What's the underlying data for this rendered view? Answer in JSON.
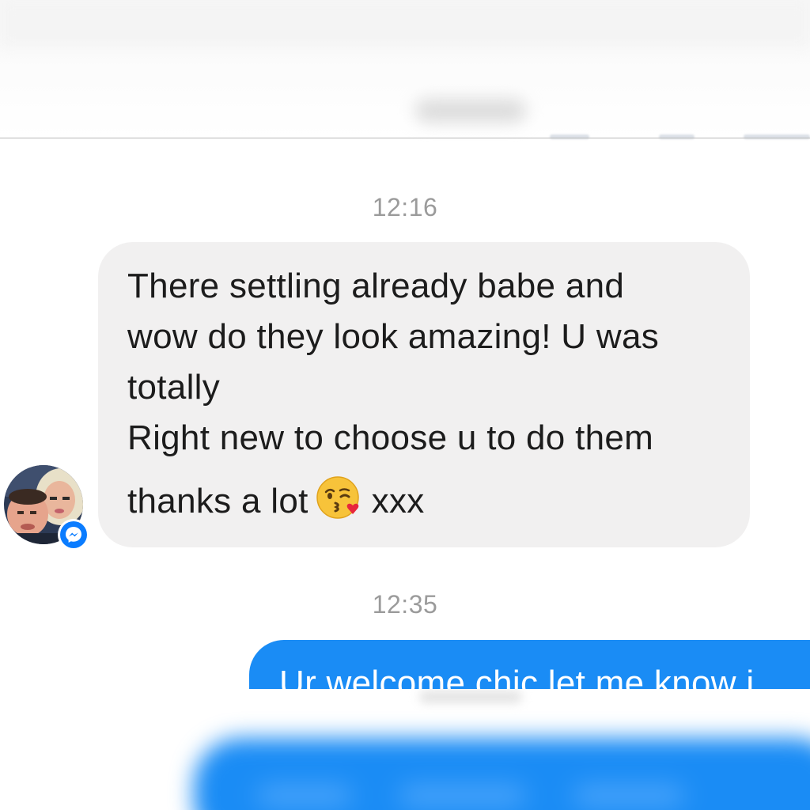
{
  "conversation": {
    "timestamp_1": "12:16",
    "incoming_message": {
      "lines": [
        "There settling already babe and",
        "wow do they look amazing! U was",
        "totally",
        "Right new to choose u to do them"
      ],
      "last_line_before_emoji": "thanks a lot",
      "emoji": "face-blowing-a-kiss-emoji",
      "last_line_after_emoji": "xxx"
    },
    "timestamp_2": "12:35",
    "outgoing_message": {
      "text": "Ur welcome chic let me know i"
    }
  },
  "sender": {
    "avatar": "profile-photo",
    "badge_icon": "messenger-icon"
  },
  "colors": {
    "incoming_bubble": "#f1f0f0",
    "outgoing_bubble": "#1a8cf5",
    "timestamp": "#9b9b9b",
    "messenger_badge": "#0a7cff"
  }
}
